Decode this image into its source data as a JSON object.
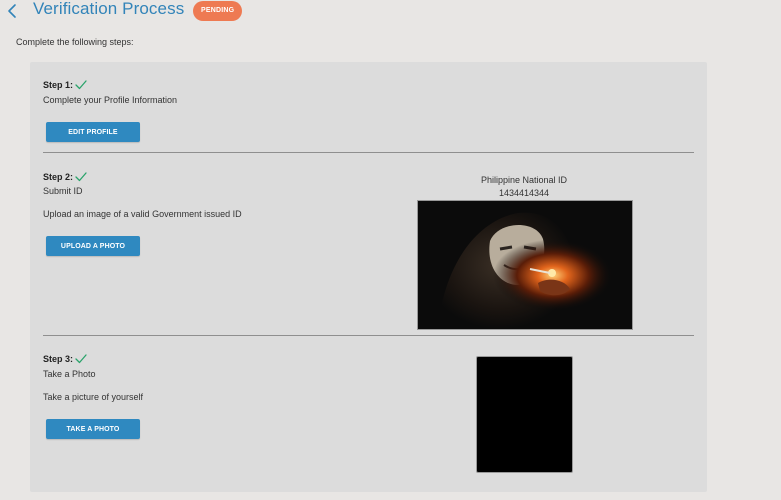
{
  "header": {
    "title": "Verification Process",
    "status": "PENDING"
  },
  "intro": "Complete the following steps:",
  "steps": [
    {
      "title": "Step 1:",
      "description": "Complete your Profile Information",
      "button_label": "EDIT PROFILE"
    },
    {
      "title": "Step 2:",
      "description": "Submit ID",
      "instruction": "Upload an image of a valid Government issued ID",
      "button_label": "UPLOAD A PHOTO",
      "id_type": "Philippine National ID",
      "id_number": "1434414344"
    },
    {
      "title": "Step 3:",
      "description": "Take a Photo",
      "instruction": "Take a picture of yourself",
      "button_label": "TAKE A PHOTO"
    }
  ],
  "colors": {
    "accent": "#2f89c0",
    "title": "#3284b9",
    "pending": "#ee7a52",
    "check": "#2aa36b"
  },
  "icons": {
    "back": "chevron-left-icon",
    "check": "check-icon"
  }
}
